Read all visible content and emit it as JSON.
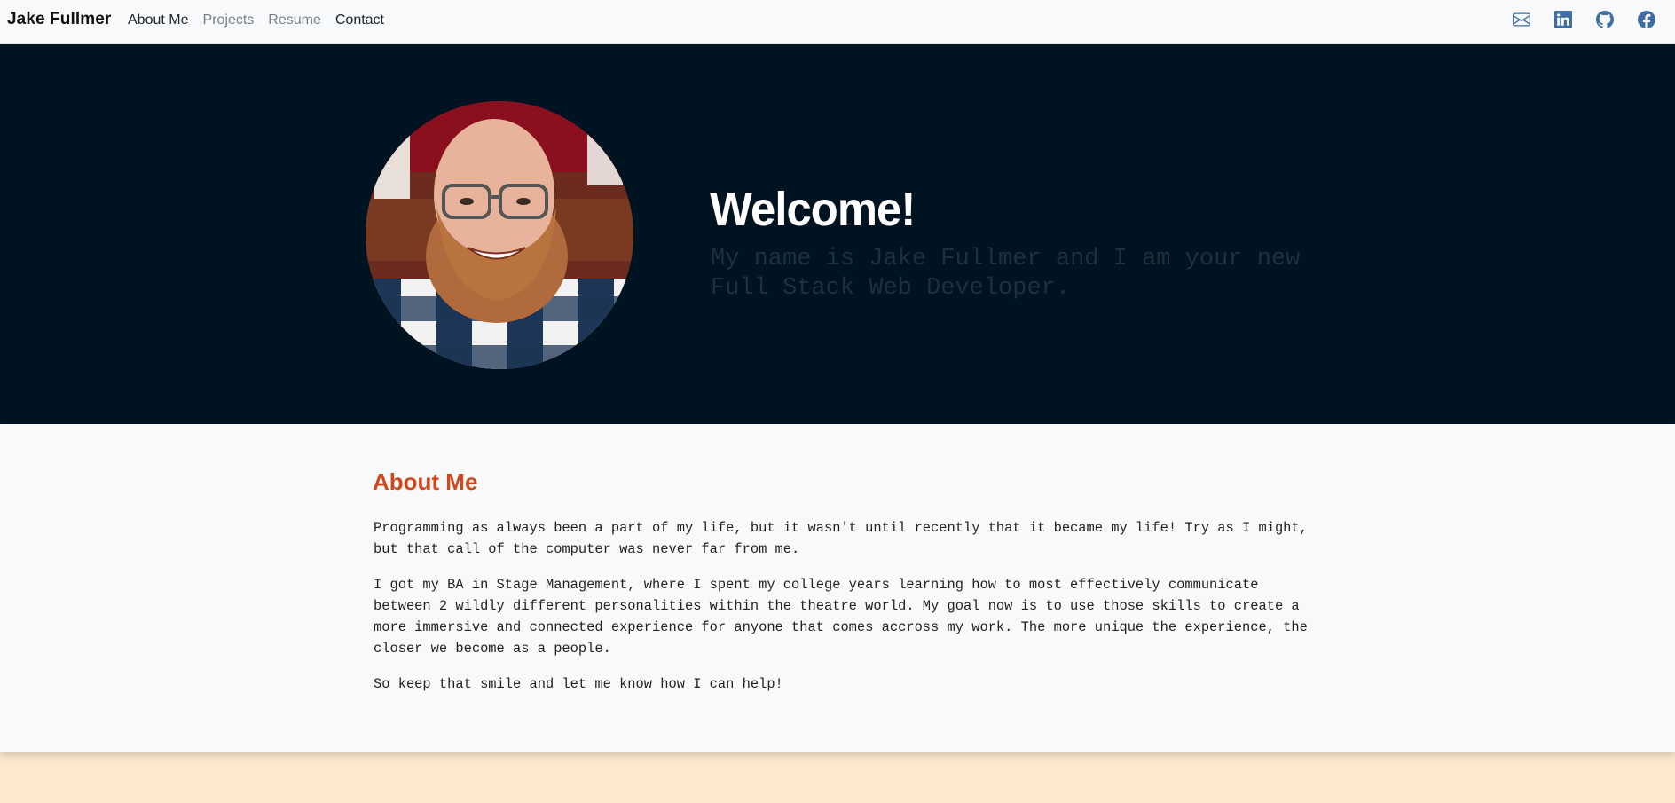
{
  "navbar": {
    "brand": "Jake Fullmer",
    "links": [
      {
        "label": "About Me",
        "state": "active"
      },
      {
        "label": "Projects",
        "state": "muted"
      },
      {
        "label": "Resume",
        "state": "muted"
      },
      {
        "label": "Contact",
        "state": "active"
      }
    ],
    "social_icons": [
      "envelope-icon",
      "linkedin-icon",
      "github-icon",
      "facebook-icon"
    ]
  },
  "hero": {
    "heading": "Welcome!",
    "tagline": "My name is Jake Fullmer and I am your new Full Stack Web Developer."
  },
  "about": {
    "title": "About Me",
    "paragraphs": [
      "Programming as always been a part of my life, but it wasn't until recently that it became my life! Try as I might, but that call of the computer was never far from me.",
      "I got my BA in Stage Management, where I spent my college years learning how to most effectively communicate between 2 wildly different personalities within the theatre world. My goal now is to use those skills to create a more immersive and connected experience for anyone that comes accross my work. The more unique the experience, the closer we become as a people.",
      "So keep that smile and let me know how I can help!"
    ]
  },
  "colors": {
    "hero_background": "#001321",
    "accent": "#d0491e",
    "icon_blue": "#3f6ea3",
    "footer_peach": "#fde9cf"
  }
}
